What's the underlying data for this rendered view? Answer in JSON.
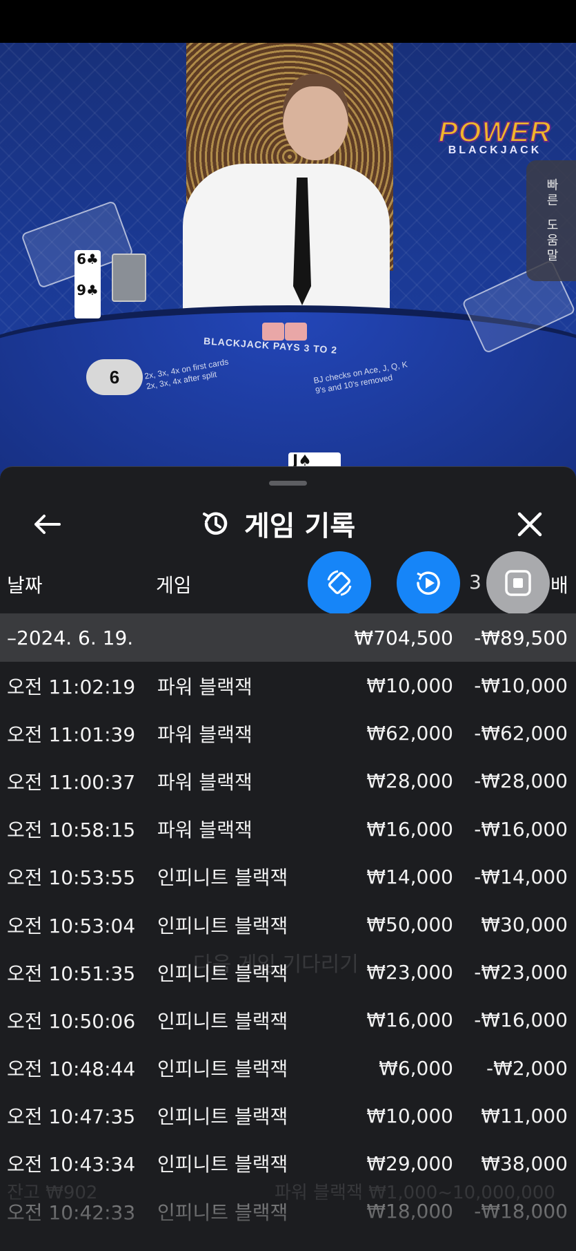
{
  "video": {
    "felt_title": "BLACKJACK PAYS 3 TO 2",
    "felt_rules_left": [
      "2x, 3x, 4x on first cards",
      "2x, 3x, 4x after split"
    ],
    "felt_rules_right": [
      "BJ checks on Ace, J, Q, K",
      "9's and 10's removed"
    ],
    "player_cards": [
      "6♣",
      "9♣"
    ],
    "player_score": "6",
    "dealer_peek_card": "J♠",
    "logo_line1": "POWER",
    "logo_line2": "BLACKJACK",
    "help_tab": [
      "빠른",
      "도움말"
    ]
  },
  "sheet": {
    "title": "게임 기록",
    "headers": {
      "date": "날짜",
      "game": "게임",
      "result": "3",
      "payout": "배"
    },
    "date_group": {
      "date": "–2024. 6. 19.",
      "bet_total": "₩704,500",
      "result_total": "-₩89,500"
    },
    "rows": [
      {
        "time": "오전 11:02:19",
        "game": "파워 블랙잭",
        "bet": "₩10,000",
        "result": "-₩10,000"
      },
      {
        "time": "오전 11:01:39",
        "game": "파워 블랙잭",
        "bet": "₩62,000",
        "result": "-₩62,000"
      },
      {
        "time": "오전 11:00:37",
        "game": "파워 블랙잭",
        "bet": "₩28,000",
        "result": "-₩28,000"
      },
      {
        "time": "오전 10:58:15",
        "game": "파워 블랙잭",
        "bet": "₩16,000",
        "result": "-₩16,000"
      },
      {
        "time": "오전 10:53:55",
        "game": "인피니트 블랙잭",
        "bet": "₩14,000",
        "result": "-₩14,000"
      },
      {
        "time": "오전 10:53:04",
        "game": "인피니트 블랙잭",
        "bet": "₩50,000",
        "result": "₩30,000"
      },
      {
        "time": "오전 10:51:35",
        "game": "인피니트 블랙잭",
        "bet": "₩23,000",
        "result": "-₩23,000"
      },
      {
        "time": "오전 10:50:06",
        "game": "인피니트 블랙잭",
        "bet": "₩16,000",
        "result": "-₩16,000"
      },
      {
        "time": "오전 10:48:44",
        "game": "인피니트 블랙잭",
        "bet": "₩6,000",
        "result": "-₩2,000"
      },
      {
        "time": "오전 10:47:35",
        "game": "인피니트 블랙잭",
        "bet": "₩10,000",
        "result": "₩11,000"
      },
      {
        "time": "오전 10:43:34",
        "game": "인피니트 블랙잭",
        "bet": "₩29,000",
        "result": "₩38,000"
      },
      {
        "time": "오전 10:42:33",
        "game": "인피니트 블랙잭",
        "bet": "₩18,000",
        "result": "-₩18,000"
      }
    ],
    "ghost_text": {
      "waiting": "다음 게임 기다리기",
      "balance": "잔고 ₩902",
      "limits": "파워 블랙잭 ₩1,000~10,000,000"
    }
  },
  "colors": {
    "sheet_bg": "#1c1d20",
    "date_row_bg": "#3a3b3e",
    "fab_blue": "#1685f8",
    "fab_grey": "#a9aaad"
  }
}
